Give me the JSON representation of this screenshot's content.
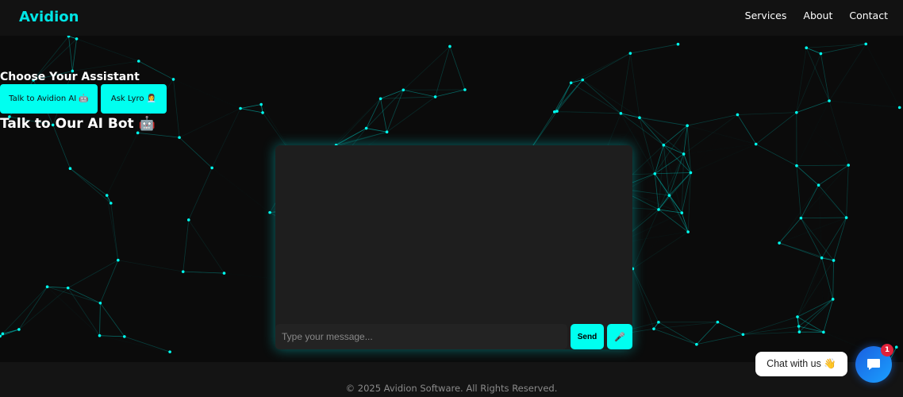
{
  "header": {
    "logo": "Avidion",
    "nav": [
      "Services",
      "About",
      "Contact"
    ]
  },
  "assistant": {
    "heading": "Choose Your Assistant",
    "buttons": [
      "Talk to Avidion AI 🤖",
      "Ask Lyro 👩‍💼"
    ],
    "bot_title": "Talk to Our AI Bot 🤖"
  },
  "chat": {
    "placeholder": "Type your message...",
    "send_label": "Send",
    "mic_label": "🎤"
  },
  "widget": {
    "label": "Chat with us 👋",
    "badge": "1"
  },
  "footer": {
    "text": "© 2025 Avidion Software. All Rights Reserved."
  },
  "colors": {
    "accent": "#00fff0",
    "network": "#00c8c0"
  }
}
